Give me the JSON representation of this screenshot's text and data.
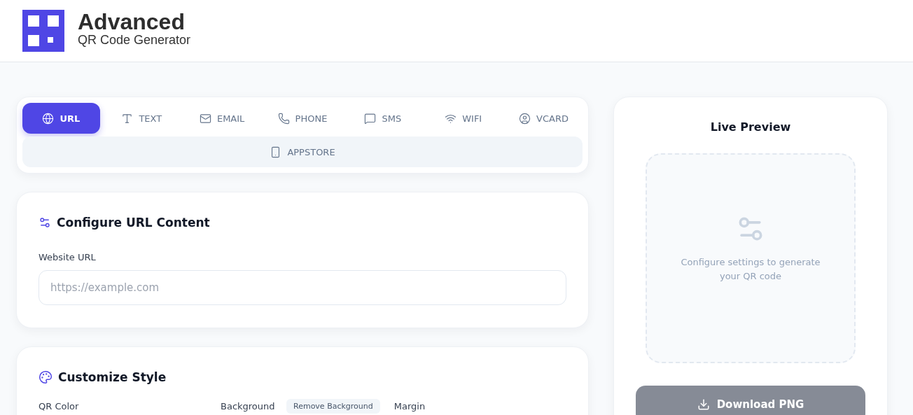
{
  "header": {
    "title": "Advanced",
    "subtitle": "QR Code Generator"
  },
  "tabs": [
    {
      "label": "URL",
      "selected": true
    },
    {
      "label": "TEXT",
      "selected": false
    },
    {
      "label": "EMAIL",
      "selected": false
    },
    {
      "label": "PHONE",
      "selected": false
    },
    {
      "label": "SMS",
      "selected": false
    },
    {
      "label": "WIFI",
      "selected": false
    },
    {
      "label": "VCARD",
      "selected": false
    },
    {
      "label": "APPSTORE",
      "selected": false
    }
  ],
  "content_card": {
    "title": "Configure URL Content",
    "field_label": "Website URL",
    "placeholder": "https://example.com"
  },
  "style_card": {
    "title": "Customize Style",
    "labels": [
      {
        "text": "QR Color",
        "kind": "label"
      },
      {
        "text": "Background",
        "kind": "label"
      },
      {
        "text": "Remove Background",
        "kind": "chip"
      },
      {
        "text": "Margin",
        "kind": "label"
      }
    ]
  },
  "preview": {
    "title": "Live Preview",
    "message": "Configure settings to generate your QR code",
    "button": "Download PNG"
  }
}
